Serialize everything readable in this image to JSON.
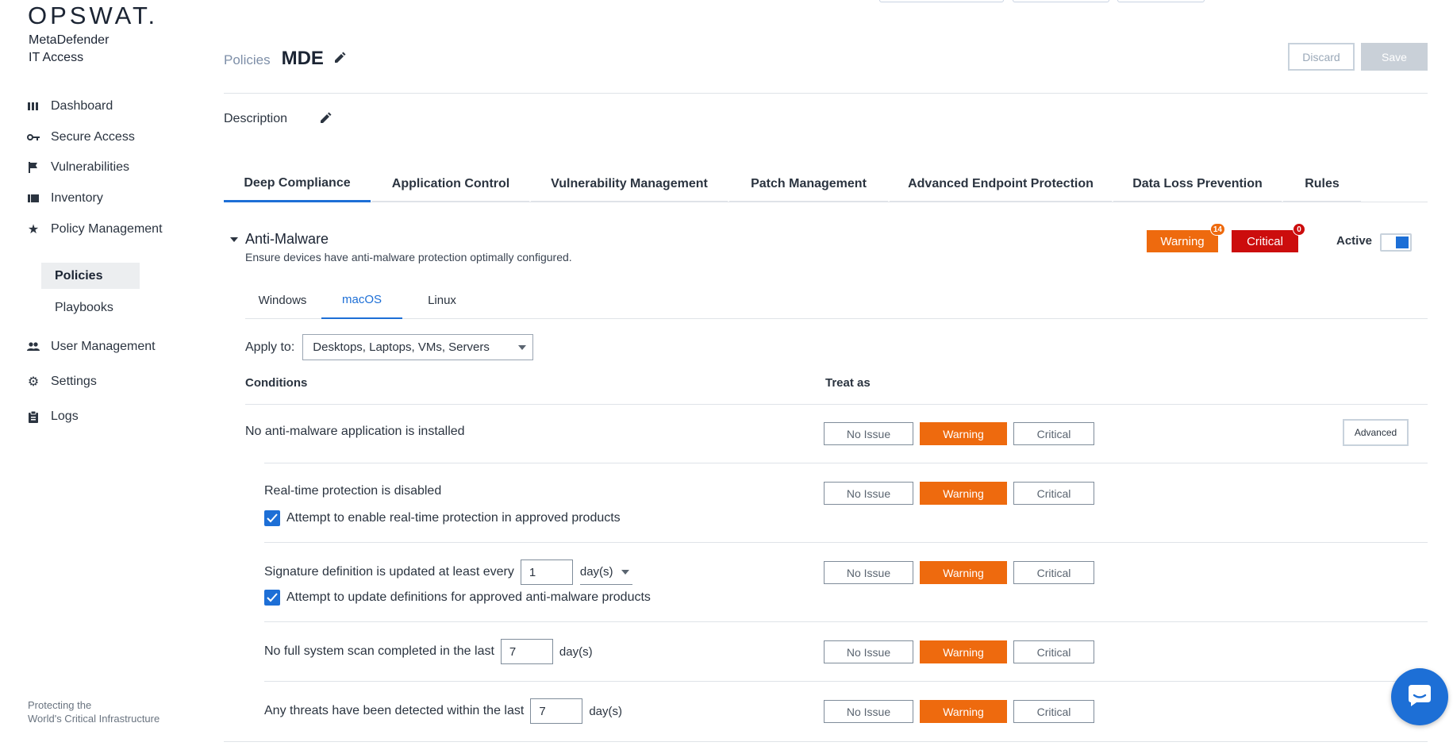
{
  "brand": {
    "logo": "OPSWAT.",
    "product_line1": "MetaDefender",
    "product_line2": "IT Access",
    "tagline_line1": "Protecting the",
    "tagline_line2": "World's Critical Infrastructure"
  },
  "sidebar": {
    "items": [
      {
        "label": "Dashboard",
        "icon": "dashboard-icon"
      },
      {
        "label": "Secure Access",
        "icon": "key-icon"
      },
      {
        "label": "Vulnerabilities",
        "icon": "flag-icon"
      },
      {
        "label": "Inventory",
        "icon": "inventory-icon"
      },
      {
        "label": "Policy Management",
        "icon": "star-icon"
      },
      {
        "label": "User Management",
        "icon": "users-icon"
      },
      {
        "label": "Settings",
        "icon": "gear-icon"
      },
      {
        "label": "Logs",
        "icon": "clipboard-icon"
      }
    ],
    "sub_items": [
      {
        "label": "Policies",
        "active": true
      },
      {
        "label": "Playbooks",
        "active": false
      }
    ]
  },
  "header": {
    "breadcrumb": "Policies",
    "title": "MDE",
    "discard_label": "Discard",
    "save_label": "Save",
    "description_label": "Description"
  },
  "tabs": [
    {
      "label": "Deep Compliance",
      "active": true
    },
    {
      "label": "Application Control",
      "active": false
    },
    {
      "label": "Vulnerability Management",
      "active": false
    },
    {
      "label": "Patch Management",
      "active": false
    },
    {
      "label": "Advanced Endpoint Protection",
      "active": false
    },
    {
      "label": "Data Loss Prevention",
      "active": false
    },
    {
      "label": "Rules",
      "active": false
    }
  ],
  "section": {
    "title": "Anti-Malware",
    "subtitle": "Ensure devices have anti-malware protection optimally configured.",
    "warning_label": "Warning",
    "warning_count": "14",
    "critical_label": "Critical",
    "critical_count": "0",
    "active_label": "Active",
    "active": true
  },
  "os_tabs": [
    {
      "label": "Windows",
      "active": false
    },
    {
      "label": "macOS",
      "active": true
    },
    {
      "label": "Linux",
      "active": false
    }
  ],
  "apply_to": {
    "label": "Apply to:",
    "value": "Desktops, Laptops, VMs, Servers"
  },
  "table": {
    "col_conditions": "Conditions",
    "col_treat_as": "Treat as",
    "treat_options": [
      "No Issue",
      "Warning",
      "Critical"
    ],
    "advanced_label": "Advanced",
    "rows": [
      {
        "text": "No anti-malware application is installed",
        "selected": "Warning"
      },
      {
        "text": "Real-time protection is disabled",
        "selected": "Warning",
        "checkbox": "Attempt to enable real-time protection in approved products"
      },
      {
        "text": "Signature definition is updated at least every",
        "value": "1",
        "unit": "day(s)",
        "selected": "Warning",
        "checkbox": "Attempt to update definitions for approved anti-malware products"
      },
      {
        "text": "No full system scan completed in the last",
        "value": "7",
        "unit": "day(s)",
        "selected": "Warning"
      },
      {
        "text": "Any threats have been detected within the last",
        "value": "7",
        "unit": "day(s)",
        "selected": "Warning"
      }
    ]
  },
  "colors": {
    "accent": "#1d6fd6",
    "warning": "#ee6a0e",
    "critical": "#cc0d0d"
  }
}
